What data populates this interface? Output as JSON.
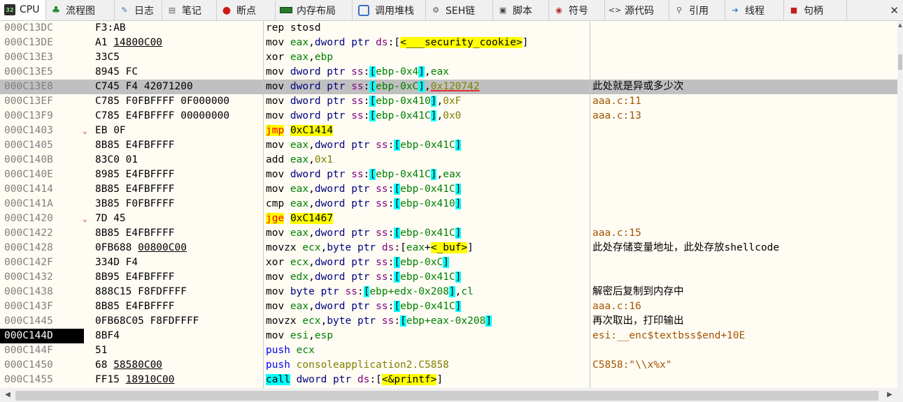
{
  "tabs": [
    {
      "label": "CPU",
      "icon": "cpu-icon"
    },
    {
      "label": "流程图",
      "icon": "flow-graph-icon"
    },
    {
      "label": "日志",
      "icon": "log-icon"
    },
    {
      "label": "笔记",
      "icon": "notes-icon"
    },
    {
      "label": "断点",
      "icon": "breakpoint-icon"
    },
    {
      "label": "内存布局",
      "icon": "memory-map-icon"
    },
    {
      "label": "调用堆栈",
      "icon": "call-stack-icon"
    },
    {
      "label": "SEH链",
      "icon": "seh-chain-icon"
    },
    {
      "label": "脚本",
      "icon": "script-icon"
    },
    {
      "label": "符号",
      "icon": "symbols-icon"
    },
    {
      "label": "源代码",
      "icon": "source-icon"
    },
    {
      "label": "引用",
      "icon": "references-icon"
    },
    {
      "label": "线程",
      "icon": "threads-icon"
    },
    {
      "label": "句柄",
      "icon": "handles-icon"
    }
  ],
  "close_glyph": "✕",
  "scroll": {
    "up": "▲",
    "left": "◀",
    "right": "▶"
  },
  "rows": [
    {
      "addr": "000C13DC",
      "arrow": "",
      "bytes": "F3:AB",
      "bu": "",
      "cmt": "",
      "cmtc": "",
      "ins": [
        [
          "rep stosd",
          "k-mn"
        ]
      ]
    },
    {
      "addr": "000C13DE",
      "arrow": "",
      "bytes": "A1 ",
      "bu": "14800C00",
      "cmt": "",
      "cmtc": "",
      "ins": [
        [
          "mov ",
          "k-mn"
        ],
        [
          "eax",
          "k-reg"
        ],
        [
          ",",
          "k-mn"
        ],
        [
          "dword ptr ",
          "k-sz"
        ],
        [
          "ds",
          "k-seg"
        ],
        [
          ":[",
          "k-mn"
        ],
        [
          "<___security_cookie>",
          "k-yl"
        ],
        [
          "]",
          "k-mn"
        ]
      ]
    },
    {
      "addr": "000C13E3",
      "arrow": "",
      "bytes": "33C5",
      "bu": "",
      "cmt": "",
      "cmtc": "",
      "ins": [
        [
          "xor ",
          "k-mn"
        ],
        [
          "eax",
          "k-reg"
        ],
        [
          ",",
          "k-mn"
        ],
        [
          "ebp",
          "k-reg"
        ]
      ]
    },
    {
      "addr": "000C13E5",
      "arrow": "",
      "bytes": "8945 FC",
      "bu": "",
      "cmt": "",
      "cmtc": "",
      "ins": [
        [
          "mov ",
          "k-mn"
        ],
        [
          "dword ptr ",
          "k-sz"
        ],
        [
          "ss",
          "k-seg"
        ],
        [
          ":",
          "k-mn"
        ],
        [
          "[",
          "k-hl"
        ],
        [
          "ebp-0x4",
          "k-reg"
        ],
        [
          "]",
          "k-hl"
        ],
        [
          ",",
          "k-mn"
        ],
        [
          "eax",
          "k-reg"
        ]
      ]
    },
    {
      "addr": "000C13E8",
      "arrow": "",
      "bytes": "C745 F4 42071200",
      "bu": "",
      "cmt": "此处就是异或多少次",
      "cmtc": "cm-norm",
      "sel": true,
      "ins": [
        [
          "mov ",
          "k-mn"
        ],
        [
          "dword ptr ",
          "k-sz"
        ],
        [
          "ss",
          "k-seg"
        ],
        [
          ":",
          "k-mn"
        ],
        [
          "[",
          "k-hl"
        ],
        [
          "ebp-0xC",
          "k-reg"
        ],
        [
          "]",
          "k-hl"
        ],
        [
          ",",
          "k-mn"
        ],
        [
          "0x120742",
          "k-num ulr"
        ]
      ]
    },
    {
      "addr": "000C13EF",
      "arrow": "",
      "bytes": "C785 F0FBFFFF 0F000000",
      "bu": "",
      "cmt": "aaa.c:11",
      "cmtc": "cm-orange",
      "ins": [
        [
          "mov ",
          "k-mn"
        ],
        [
          "dword ptr ",
          "k-sz"
        ],
        [
          "ss",
          "k-seg"
        ],
        [
          ":",
          "k-mn"
        ],
        [
          "[",
          "k-hl"
        ],
        [
          "ebp-0x410",
          "k-reg"
        ],
        [
          "]",
          "k-hl"
        ],
        [
          ",",
          "k-mn"
        ],
        [
          "0xF",
          "k-num"
        ]
      ]
    },
    {
      "addr": "000C13F9",
      "arrow": "",
      "bytes": "C785 E4FBFFFF 00000000",
      "bu": "",
      "cmt": "aaa.c:13",
      "cmtc": "cm-orange",
      "ins": [
        [
          "mov ",
          "k-mn"
        ],
        [
          "dword ptr ",
          "k-sz"
        ],
        [
          "ss",
          "k-seg"
        ],
        [
          ":",
          "k-mn"
        ],
        [
          "[",
          "k-hl"
        ],
        [
          "ebp-0x41C",
          "k-reg"
        ],
        [
          "]",
          "k-hl"
        ],
        [
          ",",
          "k-mn"
        ],
        [
          "0x0",
          "k-num"
        ]
      ]
    },
    {
      "addr": "000C1403",
      "arrow": "⌄",
      "bytes": "EB 0F",
      "bu": "",
      "cmt": "",
      "cmtc": "",
      "ins": [
        [
          "jmp",
          "k-jmp"
        ],
        [
          " ",
          "k-mn"
        ],
        [
          "0xC1414",
          "k-yl"
        ]
      ]
    },
    {
      "addr": "000C1405",
      "arrow": "",
      "bytes": "8B85 E4FBFFFF",
      "bu": "",
      "cmt": "",
      "cmtc": "",
      "ins": [
        [
          "mov ",
          "k-mn"
        ],
        [
          "eax",
          "k-reg"
        ],
        [
          ",",
          "k-mn"
        ],
        [
          "dword ptr ",
          "k-sz"
        ],
        [
          "ss",
          "k-seg"
        ],
        [
          ":",
          "k-mn"
        ],
        [
          "[",
          "k-hl"
        ],
        [
          "ebp-0x41C",
          "k-reg"
        ],
        [
          "]",
          "k-hl"
        ]
      ]
    },
    {
      "addr": "000C140B",
      "arrow": "",
      "bytes": "83C0 01",
      "bu": "",
      "cmt": "",
      "cmtc": "",
      "ins": [
        [
          "add ",
          "k-mn"
        ],
        [
          "eax",
          "k-reg"
        ],
        [
          ",",
          "k-mn"
        ],
        [
          "0x1",
          "k-num"
        ]
      ]
    },
    {
      "addr": "000C140E",
      "arrow": "",
      "bytes": "8985 E4FBFFFF",
      "bu": "",
      "cmt": "",
      "cmtc": "",
      "ins": [
        [
          "mov ",
          "k-mn"
        ],
        [
          "dword ptr ",
          "k-sz"
        ],
        [
          "ss",
          "k-seg"
        ],
        [
          ":",
          "k-mn"
        ],
        [
          "[",
          "k-hl"
        ],
        [
          "ebp-0x41C",
          "k-reg"
        ],
        [
          "]",
          "k-hl"
        ],
        [
          ",",
          "k-mn"
        ],
        [
          "eax",
          "k-reg"
        ]
      ]
    },
    {
      "addr": "000C1414",
      "arrow": "",
      "bytes": "8B85 E4FBFFFF",
      "bu": "",
      "cmt": "",
      "cmtc": "",
      "ins": [
        [
          "mov ",
          "k-mn"
        ],
        [
          "eax",
          "k-reg"
        ],
        [
          ",",
          "k-mn"
        ],
        [
          "dword ptr ",
          "k-sz"
        ],
        [
          "ss",
          "k-seg"
        ],
        [
          ":",
          "k-mn"
        ],
        [
          "[",
          "k-hl"
        ],
        [
          "ebp-0x41C",
          "k-reg"
        ],
        [
          "]",
          "k-hl"
        ]
      ]
    },
    {
      "addr": "000C141A",
      "arrow": "",
      "bytes": "3B85 F0FBFFFF",
      "bu": "",
      "cmt": "",
      "cmtc": "",
      "ins": [
        [
          "cmp ",
          "k-mn"
        ],
        [
          "eax",
          "k-reg"
        ],
        [
          ",",
          "k-mn"
        ],
        [
          "dword ptr ",
          "k-sz"
        ],
        [
          "ss",
          "k-seg"
        ],
        [
          ":",
          "k-mn"
        ],
        [
          "[",
          "k-hl"
        ],
        [
          "ebp-0x410",
          "k-reg"
        ],
        [
          "]",
          "k-hl"
        ]
      ]
    },
    {
      "addr": "000C1420",
      "arrow": "⌄",
      "bytes": "7D 45",
      "bu": "",
      "cmt": "",
      "cmtc": "",
      "ins": [
        [
          "jge",
          "k-jmp"
        ],
        [
          " ",
          "k-mn"
        ],
        [
          "0xC1467",
          "k-yl"
        ]
      ]
    },
    {
      "addr": "000C1422",
      "arrow": "",
      "bytes": "8B85 E4FBFFFF",
      "bu": "",
      "cmt": "aaa.c:15",
      "cmtc": "cm-orange",
      "ins": [
        [
          "mov ",
          "k-mn"
        ],
        [
          "eax",
          "k-reg"
        ],
        [
          ",",
          "k-mn"
        ],
        [
          "dword ptr ",
          "k-sz"
        ],
        [
          "ss",
          "k-seg"
        ],
        [
          ":",
          "k-mn"
        ],
        [
          "[",
          "k-hl"
        ],
        [
          "ebp-0x41C",
          "k-reg"
        ],
        [
          "]",
          "k-hl"
        ]
      ]
    },
    {
      "addr": "000C1428",
      "arrow": "",
      "bytes": "0FB688 ",
      "bu": "00800C00",
      "cmt": "此处存储变量地址，此处存放shellcode",
      "cmtc": "cm-norm",
      "ins": [
        [
          "movzx ",
          "k-mn"
        ],
        [
          "ecx",
          "k-reg"
        ],
        [
          ",",
          "k-mn"
        ],
        [
          "byte ptr ",
          "k-sz"
        ],
        [
          "ds",
          "k-seg"
        ],
        [
          ":[",
          "k-mn"
        ],
        [
          "eax",
          "k-reg"
        ],
        [
          "+",
          "k-mn"
        ],
        [
          "<_buf>",
          "k-yl"
        ],
        [
          "]",
          "k-mn"
        ]
      ]
    },
    {
      "addr": "000C142F",
      "arrow": "",
      "bytes": "334D F4",
      "bu": "",
      "cmt": "",
      "cmtc": "",
      "ins": [
        [
          "xor ",
          "k-mn"
        ],
        [
          "ecx",
          "k-reg"
        ],
        [
          ",",
          "k-mn"
        ],
        [
          "dword ptr ",
          "k-sz"
        ],
        [
          "ss",
          "k-seg"
        ],
        [
          ":",
          "k-mn"
        ],
        [
          "[",
          "k-hl"
        ],
        [
          "ebp-0xC",
          "k-reg"
        ],
        [
          "]",
          "k-hl"
        ]
      ]
    },
    {
      "addr": "000C1432",
      "arrow": "",
      "bytes": "8B95 E4FBFFFF",
      "bu": "",
      "cmt": "",
      "cmtc": "",
      "ins": [
        [
          "mov ",
          "k-mn"
        ],
        [
          "edx",
          "k-reg"
        ],
        [
          ",",
          "k-mn"
        ],
        [
          "dword ptr ",
          "k-sz"
        ],
        [
          "ss",
          "k-seg"
        ],
        [
          ":",
          "k-mn"
        ],
        [
          "[",
          "k-hl"
        ],
        [
          "ebp-0x41C",
          "k-reg"
        ],
        [
          "]",
          "k-hl"
        ]
      ]
    },
    {
      "addr": "000C1438",
      "arrow": "",
      "bytes": "888C15 F8FDFFFF",
      "bu": "",
      "cmt": "解密后复制到内存中",
      "cmtc": "cm-norm",
      "ins": [
        [
          "mov ",
          "k-mn"
        ],
        [
          "byte ptr ",
          "k-sz"
        ],
        [
          "ss",
          "k-seg"
        ],
        [
          ":",
          "k-mn"
        ],
        [
          "[",
          "k-hl"
        ],
        [
          "ebp+edx-0x208",
          "k-reg"
        ],
        [
          "]",
          "k-hl"
        ],
        [
          ",",
          "k-mn"
        ],
        [
          "cl",
          "k-reg"
        ]
      ]
    },
    {
      "addr": "000C143F",
      "arrow": "",
      "bytes": "8B85 E4FBFFFF",
      "bu": "",
      "cmt": "aaa.c:16",
      "cmtc": "cm-orange",
      "ins": [
        [
          "mov ",
          "k-mn"
        ],
        [
          "eax",
          "k-reg"
        ],
        [
          ",",
          "k-mn"
        ],
        [
          "dword ptr ",
          "k-sz"
        ],
        [
          "ss",
          "k-seg"
        ],
        [
          ":",
          "k-mn"
        ],
        [
          "[",
          "k-hl"
        ],
        [
          "ebp-0x41C",
          "k-reg"
        ],
        [
          "]",
          "k-hl"
        ]
      ]
    },
    {
      "addr": "000C1445",
      "arrow": "",
      "bytes": "0FB68C05 F8FDFFFF",
      "bu": "",
      "cmt": "再次取出，打印输出",
      "cmtc": "cm-norm",
      "ins": [
        [
          "movzx ",
          "k-mn"
        ],
        [
          "ecx",
          "k-reg"
        ],
        [
          ",",
          "k-mn"
        ],
        [
          "byte ptr ",
          "k-sz"
        ],
        [
          "ss",
          "k-seg"
        ],
        [
          ":",
          "k-mn"
        ],
        [
          "[",
          "k-hl"
        ],
        [
          "ebp+eax-0x208",
          "k-reg"
        ],
        [
          "]",
          "k-hl"
        ]
      ]
    },
    {
      "addr": "000C144D",
      "arrow": "",
      "bytes": "8BF4",
      "bu": "",
      "cmt": "esi:__enc$textbss$end+10E",
      "cmtc": "cm-orange",
      "cur": true,
      "ins": [
        [
          "mov ",
          "k-mn"
        ],
        [
          "esi",
          "k-reg"
        ],
        [
          ",",
          "k-mn"
        ],
        [
          "esp",
          "k-reg"
        ]
      ]
    },
    {
      "addr": "000C144F",
      "arrow": "",
      "bytes": "51",
      "bu": "",
      "cmt": "",
      "cmtc": "",
      "ins": [
        [
          "push",
          "k-push"
        ],
        [
          " ",
          "k-mn"
        ],
        [
          "ecx",
          "k-reg"
        ]
      ]
    },
    {
      "addr": "000C1450",
      "arrow": "",
      "bytes": "68 ",
      "bu": "58580C00",
      "cmt": "C5858:\"\\\\x%x\"",
      "cmtc": "cm-orange",
      "ins": [
        [
          "push",
          "k-push"
        ],
        [
          " ",
          "k-mn"
        ],
        [
          "consoleapplication2.C5858",
          "k-num"
        ]
      ]
    },
    {
      "addr": "000C1455",
      "arrow": "",
      "bytes": "FF15 ",
      "bu": "18910C00",
      "cmt": "",
      "cmtc": "",
      "ins": [
        [
          "call",
          "k-call"
        ],
        [
          " ",
          "k-mn"
        ],
        [
          "dword ptr ",
          "k-sz"
        ],
        [
          "ds",
          "k-seg"
        ],
        [
          ":[",
          "k-mn"
        ],
        [
          "<&printf>",
          "k-yl"
        ],
        [
          "]",
          "k-mn"
        ]
      ]
    }
  ]
}
